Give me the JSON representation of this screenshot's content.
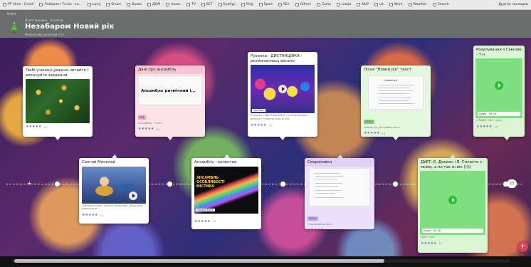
{
  "bookmarks": [
    {
      "label": "PF Aline - Gmail"
    },
    {
      "label": "Лабиринт Толас - tu..."
    },
    {
      "label": "Lang"
    },
    {
      "label": "Smart"
    },
    {
      "label": "Banks"
    },
    {
      "label": "ДОМ"
    },
    {
      "label": "music"
    },
    {
      "label": "TV"
    },
    {
      "label": "ВЕТ"
    },
    {
      "label": "Бурбур"
    },
    {
      "label": "Mag"
    },
    {
      "label": "Sport"
    },
    {
      "label": "SEo"
    },
    {
      "label": "Gifters"
    },
    {
      "label": "Comp"
    },
    {
      "label": "наши"
    },
    {
      "label": "NUP"
    },
    {
      "label": "uit"
    },
    {
      "label": "Work"
    },
    {
      "label": "Weather"
    },
    {
      "label": "Search"
    }
  ],
  "bookmarks_right": "Другие закладки",
  "header": {
    "crumb": "Padlet",
    "by": "Ольга Іванівна · 1h назад",
    "title": "Незабаром Новий рік",
    "subtitle": "Новорічний шкільний стіл"
  },
  "timeline_count": "23",
  "cards": [
    {
      "title": "Любі учениці уважно читайте і виконуйте завдання.",
      "rating": "★★★★★",
      "count": "12"
    },
    {
      "title": "Дані про ансамбль",
      "doc_text": "Ансамбль ритмічний і...",
      "tag": "PDF",
      "small": "Ансамбль - текст",
      "rating": "★★★★★",
      "count": "10"
    },
    {
      "title": "Руханка - ДИСТАНЦІЙКА - розминаємось весело",
      "badge": "YouTube",
      "small": "Руханка - ДИСТАНЦІЙКА - розминаємось весело | Руханка для дітей",
      "rating": "★★★★★",
      "count": "11"
    },
    {
      "title": "Пісня \"Новий рік\" текст",
      "doc_text": "Новий рік",
      "tag": "DOCX",
      "small": "Новий рік_Ансамбль.docx",
      "rating": "★★★★★",
      "count": "12"
    },
    {
      "title": "Розучування з Ганною - Т н",
      "audio": "Аудіо · 00:16",
      "small": "НОВИЙ РІК 1 нота",
      "rating": "★★★★★",
      "count": "11"
    },
    {
      "title": "Святий Миколай",
      "small": "Лятописи про Святого Миколая. Пісня для дошкільнят",
      "rating": "★★★★★",
      "count": "10"
    },
    {
      "title": "Ансамбль - колектив",
      "badge": "Google Docs",
      "image_text": "АНСАМБЛЬ\nОСОБЛИВОСТІ\nМІСТИКА",
      "rating": "★★★★★",
      "count": "13"
    },
    {
      "title": "Скоромовки",
      "tag": "DOCX",
      "small": "Скоромовки.docx",
      "rating": "★★★★★",
      "count": "10"
    },
    {
      "title": "ДУЕТ: Є. Дакаян і Я. Спласте з мною, а не так ні він )))))",
      "audio": "Аудіо · 02:18",
      "small": "ДУЕТ.mp3",
      "rating": "★★★★★",
      "count": "10"
    }
  ],
  "fab_label": "+",
  "colors": {
    "accent": "#7862b6",
    "fab": "#ea3b55",
    "header_bg": "#6a6f6d",
    "pink_card": "#f7c6d0",
    "purple_card": "#e7d6f7",
    "green_card": "#caf3c6",
    "audio_green": "#7ee07e"
  },
  "icons": [
    "padlet-logo-icon",
    "more-menu-icon",
    "play-icon",
    "plus-icon"
  ]
}
